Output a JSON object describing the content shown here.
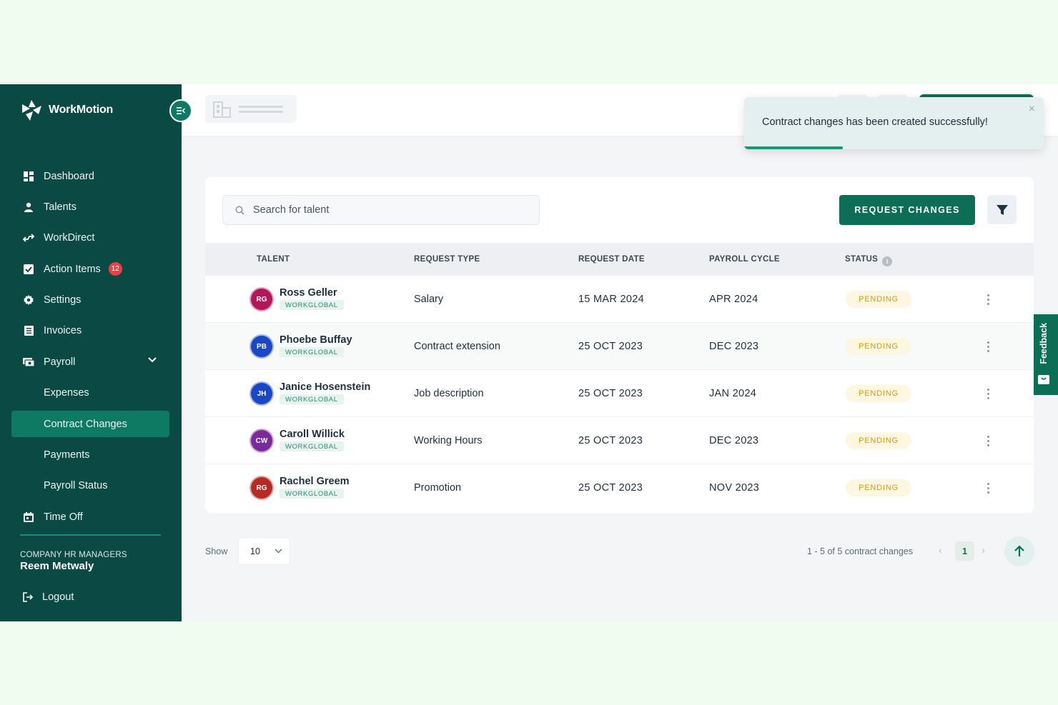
{
  "brand": {
    "name": "WorkMotion"
  },
  "sidebar": {
    "items": [
      {
        "label": "Dashboard",
        "icon": "dashboard-icon"
      },
      {
        "label": "Talents",
        "icon": "person-icon"
      },
      {
        "label": "WorkDirect",
        "icon": "workdirect-icon"
      },
      {
        "label": "Action Items",
        "icon": "checkbox-icon",
        "badge": "12"
      },
      {
        "label": "Settings",
        "icon": "gear-icon"
      },
      {
        "label": "Invoices",
        "icon": "invoice-icon"
      },
      {
        "label": "Payroll",
        "icon": "payroll-icon"
      },
      {
        "label": "Expenses"
      },
      {
        "label": "Contract Changes",
        "active": true
      },
      {
        "label": "Payments"
      },
      {
        "label": "Payroll Status"
      },
      {
        "label": "Time Off",
        "icon": "calendar-icon"
      }
    ],
    "role": "COMPANY HR MANAGERS",
    "user_name": "Reem Metwaly",
    "logout": "Logout"
  },
  "toast": {
    "message": "Contract changes has been created successfully!",
    "close": "×",
    "progress": 0.33
  },
  "search": {
    "placeholder": "Search for talent"
  },
  "actions": {
    "request_changes": "REQUEST CHANGES"
  },
  "table": {
    "headers": {
      "talent": "TALENT",
      "request_type": "REQUEST TYPE",
      "request_date": "REQUEST DATE",
      "payroll_cycle": "PAYROLL CYCLE",
      "status": "STATUS"
    },
    "rows": [
      {
        "initials": "RG",
        "name": "Ross Geller",
        "tag": "WORKGLOBAL",
        "type": "Salary",
        "date": "15 MAR 2024",
        "cycle": "APR 2024",
        "status": "PENDING",
        "avatar_color": "#b3175a"
      },
      {
        "initials": "PB",
        "name": "Phoebe Buffay",
        "tag": "WORKGLOBAL",
        "type": "Contract extension",
        "date": "25 OCT 2023",
        "cycle": "DEC 2023",
        "status": "PENDING",
        "avatar_color": "#1c47c4"
      },
      {
        "initials": "JH",
        "name": "Janice Hosenstein",
        "tag": "WORKGLOBAL",
        "type": "Job description",
        "date": "25 OCT 2023",
        "cycle": "JAN 2024",
        "status": "PENDING",
        "avatar_color": "#1c47c4"
      },
      {
        "initials": "CW",
        "name": "Caroll Willick",
        "tag": "WORKGLOBAL",
        "type": "Working Hours",
        "date": "25 OCT 2023",
        "cycle": "DEC 2023",
        "status": "PENDING",
        "avatar_color": "#7a2a9a"
      },
      {
        "initials": "RG",
        "name": "Rachel Greem",
        "tag": "WORKGLOBAL",
        "type": "Promotion",
        "date": "25 OCT 2023",
        "cycle": "NOV 2023",
        "status": "PENDING",
        "avatar_color": "#b52b24"
      }
    ]
  },
  "footer": {
    "show_label": "Show",
    "page_size": "10",
    "range": "1 - 5 of 5 contract changes",
    "page": "1",
    "prev": "‹",
    "next": "›"
  },
  "feedback": {
    "label": "Feedback"
  }
}
